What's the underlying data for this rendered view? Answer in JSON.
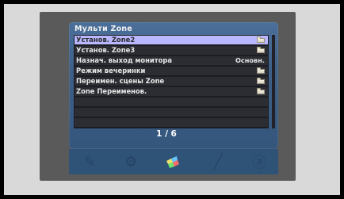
{
  "menu": {
    "title": "Мульти Zone",
    "items": [
      {
        "label": "Установ. Zone2",
        "right_icon": "folder-icon",
        "selected": true
      },
      {
        "label": "Установ. Zone3",
        "right_icon": "folder-icon"
      },
      {
        "label": "Назнач. выход монитора",
        "value": "Основн."
      },
      {
        "label": "Режим вечеринки",
        "right_icon": "folder-icon"
      },
      {
        "label": "Переимен. сцены Zone",
        "right_icon": "folder-icon"
      },
      {
        "label": "Zone Переименов.",
        "right_icon": "folder-icon"
      },
      {
        "label": ""
      },
      {
        "label": ""
      },
      {
        "label": ""
      }
    ],
    "page_indicator": "1 / 6"
  },
  "bottom_icons": [
    {
      "name": "tools-icon",
      "active": false
    },
    {
      "name": "settings-icon",
      "active": false
    },
    {
      "name": "multi-zone-icon",
      "active": true
    },
    {
      "name": "wrench-icon",
      "active": false
    },
    {
      "name": "abc-icon",
      "active": false
    }
  ],
  "colors": {
    "selected_row": "#b9b7ff",
    "row_bg": "#2b2d33",
    "panel_bg": "#3f6189",
    "icon_bar_bg": "#2f5277"
  }
}
